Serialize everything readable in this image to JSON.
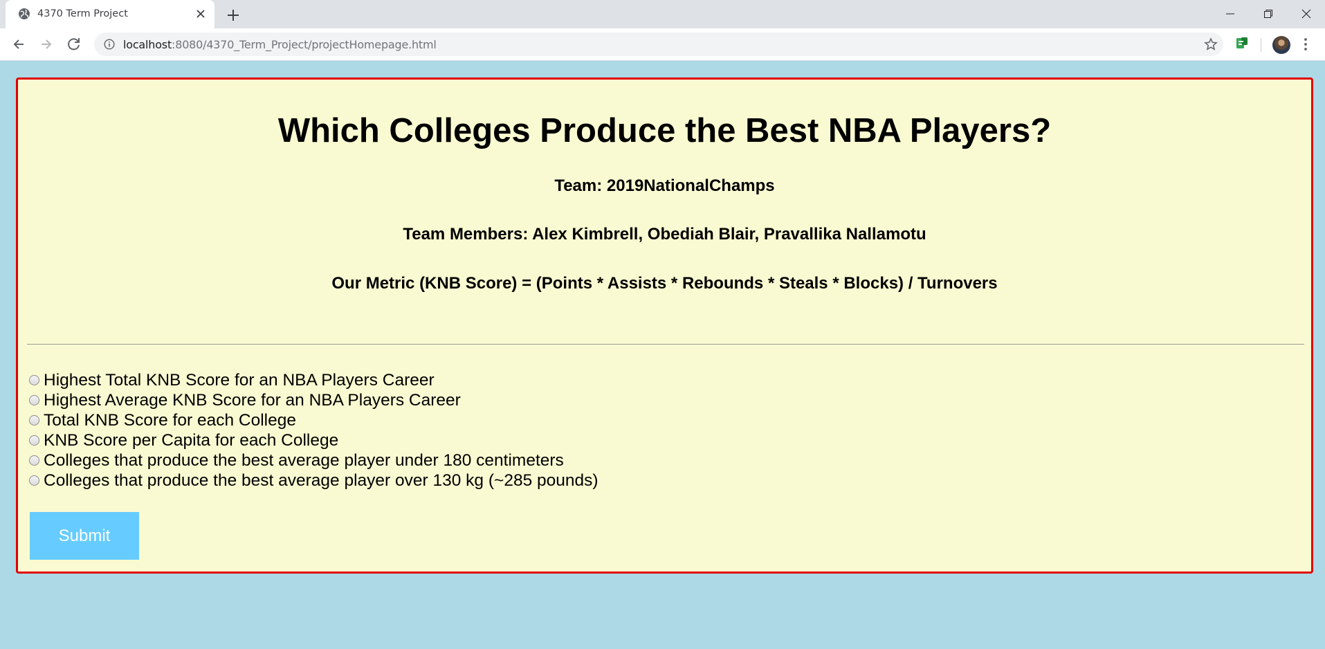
{
  "browser": {
    "tab_title": "4370 Term Project",
    "url_host": "localhost",
    "url_path": ":8080/4370_Term_Project/projectHomepage.html"
  },
  "page": {
    "title": "Which Colleges Produce the Best NBA Players?",
    "team": "Team: 2019NationalChamps",
    "members": "Team Members: Alex Kimbrell, Obediah Blair, Pravallika Nallamotu",
    "metric": "Our Metric (KNB Score) = (Points * Assists * Rebounds * Steals * Blocks) / Turnovers",
    "options": [
      {
        "label": "Highest Total KNB Score for an NBA Players Career",
        "checked": false
      },
      {
        "label": "Highest Average KNB Score for an NBA Players Career",
        "checked": false
      },
      {
        "label": "Total KNB Score for each College",
        "checked": false
      },
      {
        "label": "KNB Score per Capita for each College",
        "checked": false
      },
      {
        "label": "Colleges that produce the best average player under 180 centimeters",
        "checked": false
      },
      {
        "label": "Colleges that produce the best average player over 130 kg (~285 pounds)",
        "checked": false
      }
    ],
    "submit_label": "Submit"
  },
  "colors": {
    "page_background": "#add8e6",
    "card_background": "#fafad2",
    "card_border": "#e00000",
    "submit_background": "#66ccff"
  }
}
